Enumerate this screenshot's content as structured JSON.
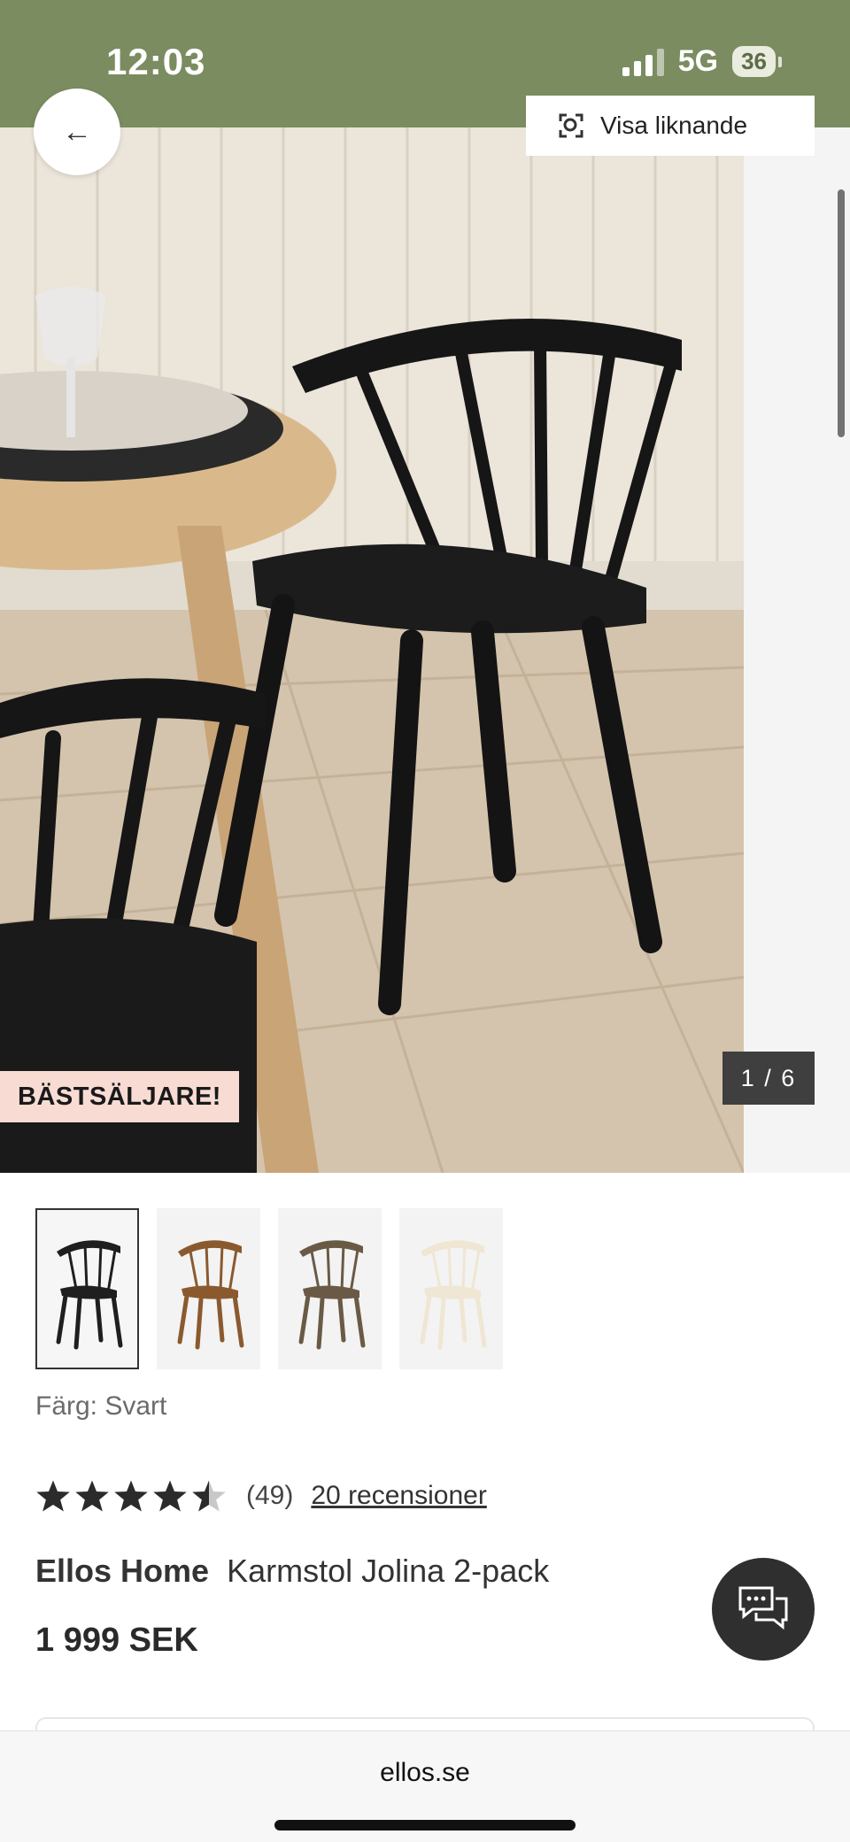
{
  "status_bar": {
    "time": "12:03",
    "network": "5G",
    "battery": "36"
  },
  "gallery": {
    "similar_label": "Visa liknande",
    "badge": "BÄSTSÄLJARE!",
    "counter": "1 / 6"
  },
  "thumbnails": [
    {
      "color": "#1f1f1f",
      "selected": true
    },
    {
      "color": "#8a5a2e",
      "selected": false
    },
    {
      "color": "#6a5a45",
      "selected": false
    },
    {
      "color": "#efe6d3",
      "selected": false
    }
  ],
  "product": {
    "color_label": "Färg: Svart",
    "rating": 4.5,
    "rating_count": "(49)",
    "reviews_link": "20 recensioner",
    "brand": "Ellos Home",
    "name": "Karmstol Jolina 2-pack",
    "price": "1 999 SEK"
  },
  "browser": {
    "url": "ellos.se"
  },
  "colors": {
    "status_bar": "#7b8c60",
    "chat_button": "#2f2f2f",
    "badge": "#f8dcd4"
  }
}
